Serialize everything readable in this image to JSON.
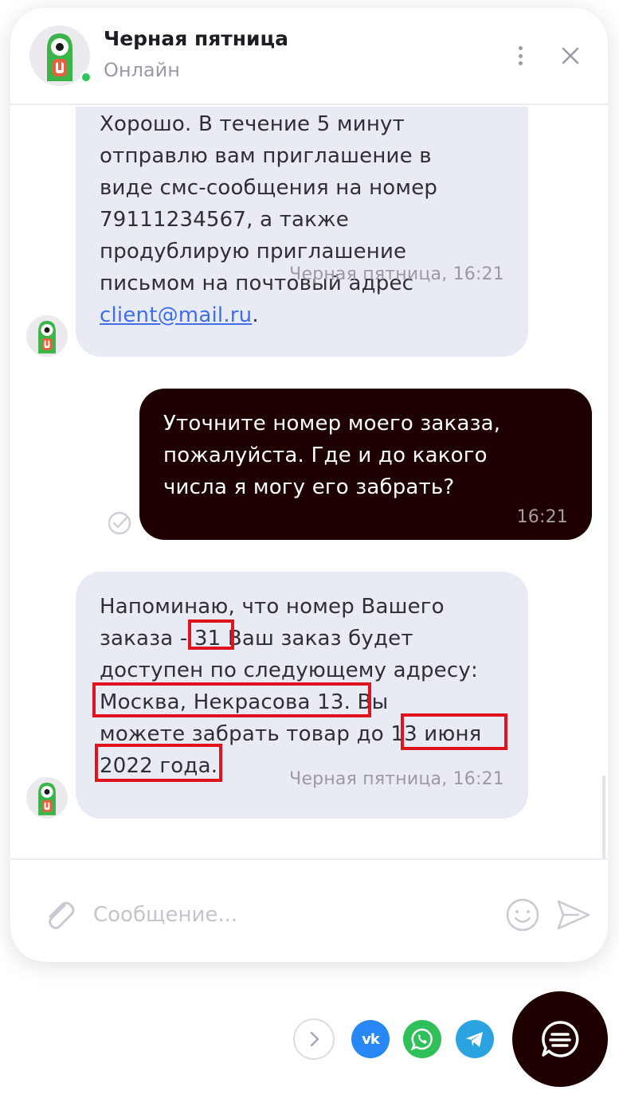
{
  "header": {
    "title": "Черная пятница",
    "status": "Онлайн",
    "status_color": "#2ec55c",
    "menu_icon": "more-vertical-icon",
    "close_icon": "close-icon"
  },
  "messages": [
    {
      "direction": "incoming",
      "lines": [
        "Хорошо. В течение 5 минут",
        "отправлю вам приглашение в",
        "виде смс-сообщения на номер",
        "79111234567, а также",
        "продублирую приглашение",
        "письмом на почтовый адрес"
      ],
      "link": "client@mail.ru",
      "link_suffix": ".",
      "sender": "Черная пятница",
      "time": "16:21"
    },
    {
      "direction": "outgoing",
      "lines": [
        "Уточните номер моего заказа,",
        "пожалуйста. Где и до какого",
        "числа я могу его забрать?"
      ],
      "time": "16:21",
      "status_icon": "check-circle-icon"
    },
    {
      "direction": "incoming",
      "line1": "Напоминаю, что номер Вашего",
      "line2_a": "заказа ",
      "line2_hl": "- 31",
      "line2_b": " Ваш заказ будет",
      "line3": "доступен по следующему адресу:",
      "line4_hl": "Москва, Некрасова 13",
      "line4_b": ". Вы",
      "line5_a": "можете забрать товар до ",
      "line5_hl": "13 июня",
      "line6_hl": "2022 года",
      "line6_b": ".",
      "sender": "Черная пятница",
      "time": "16:21"
    }
  ],
  "composer": {
    "placeholder": "Сообщение...",
    "attach_icon": "paperclip-icon",
    "emoji_icon": "smile-icon",
    "send_icon": "send-icon"
  },
  "footer": {
    "vk_label": "vk",
    "buttons": [
      "chevron-right-icon",
      "vk-icon",
      "whatsapp-icon",
      "telegram-icon",
      "chat-icon"
    ]
  },
  "colors": {
    "incoming_bubble": "#e8eaf4",
    "outgoing_bubble": "#1f0000",
    "highlight": "#e0141e",
    "link": "#3f6ee8"
  }
}
